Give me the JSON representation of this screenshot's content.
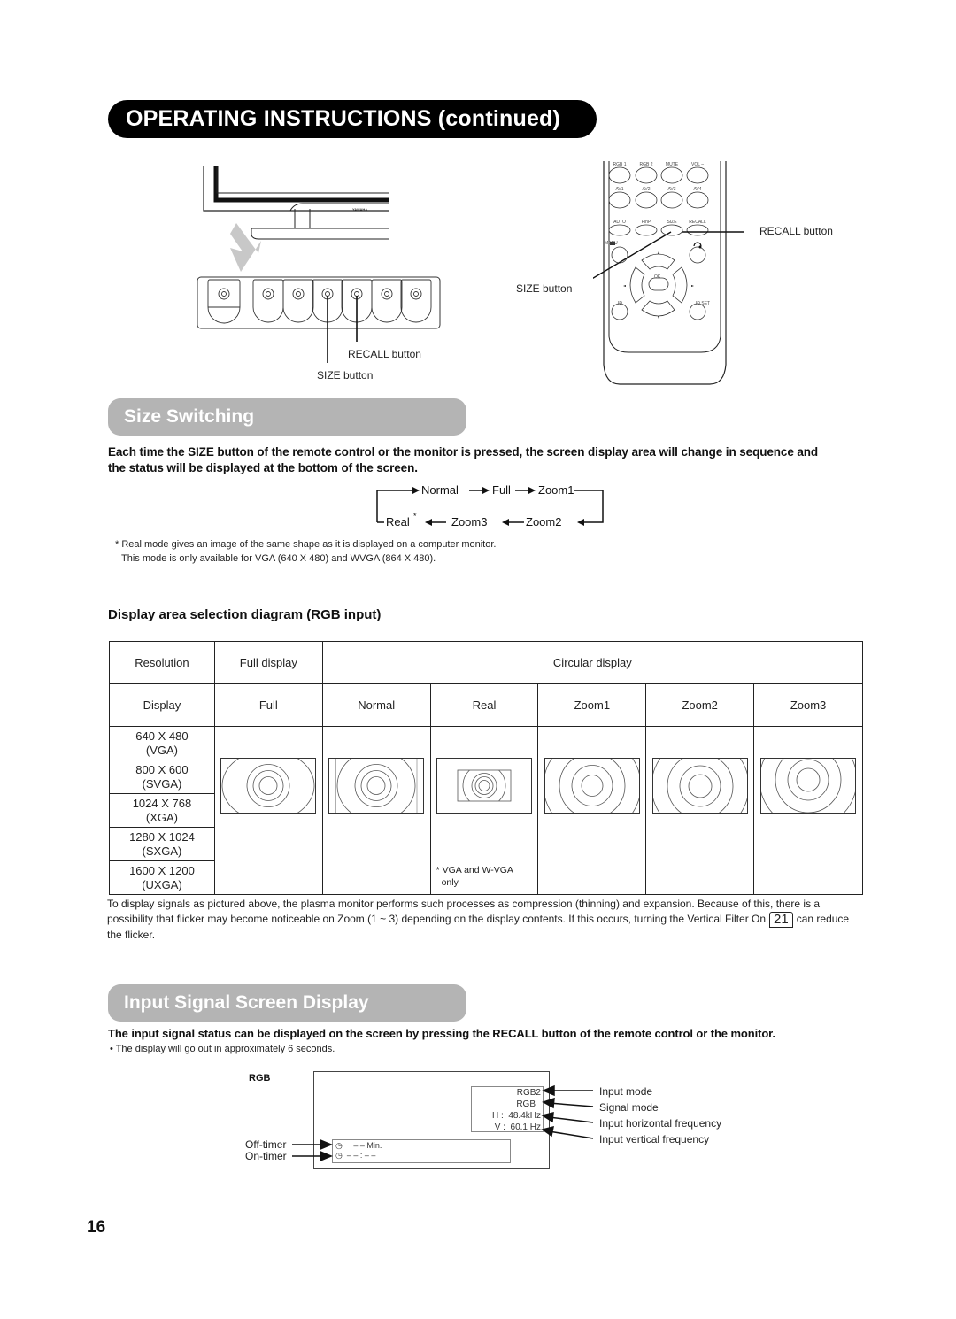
{
  "header": {
    "title": "OPERATING INSTRUCTIONS (continued)"
  },
  "monitor_figure": {
    "brand_mark": "YAMAHA",
    "callouts": {
      "recall": "RECALL button",
      "size": "SIZE button"
    }
  },
  "remote_figure": {
    "button_rows": [
      [
        "RGB 1",
        "RGB 2",
        "MUTE",
        "VOL –"
      ],
      [
        "AV1",
        "AV2",
        "AV3",
        "AV4"
      ],
      [
        "AUTO",
        "PinP",
        "SIZE",
        "RECALL"
      ]
    ],
    "menu_label": "MENU",
    "ok_label": "OK",
    "id_label": "ID",
    "id_set_label": "ID SET",
    "callouts": {
      "recall": "RECALL button",
      "size": "SIZE button"
    }
  },
  "size_switching": {
    "title": "Size Switching",
    "intro": "Each time the SIZE button of the remote control or the monitor is pressed, the screen display area will change in sequence and the status will be displayed at the bottom of the screen.",
    "cycle_top": [
      "Normal",
      "Full",
      "Zoom1"
    ],
    "cycle_bottom": [
      "Real",
      "Zoom3",
      "Zoom2"
    ],
    "real_asterisk": "*",
    "footnote_line1": "* Real mode gives an image of the same shape as it is displayed on a computer monitor.",
    "footnote_line2": "This mode is only available for VGA (640 X 480) and WVGA (864 X 480)."
  },
  "display_area": {
    "heading": "Display area selection diagram (RGB input)",
    "header_row": {
      "resolution": "Resolution",
      "full_display": "Full display",
      "circular_display": "Circular display"
    },
    "display_row": [
      "Display",
      "Full",
      "Normal",
      "Real",
      "Zoom1",
      "Zoom2",
      "Zoom3"
    ],
    "resolutions": [
      {
        "res": "640 X 480",
        "name": "(VGA)"
      },
      {
        "res": "800 X 600",
        "name": "(SVGA)"
      },
      {
        "res": "1024 X 768",
        "name": "(XGA)"
      },
      {
        "res": "1280 X 1024",
        "name": "(SXGA)"
      },
      {
        "res": "1600 X 1200",
        "name": "(UXGA)"
      }
    ],
    "real_note_line1": "* VGA and W-VGA",
    "real_note_line2": "only",
    "note_before": "To display signals as pictured above, the plasma monitor performs such processes as compression (thinning) and expansion. Because of this, there is a possibility that flicker may become noticeable on Zoom (1 ~ 3) depending on the display contents. If this occurs, turning the Vertical Filter On",
    "page_ref": "21",
    "note_after": "can reduce the flicker."
  },
  "input_signal": {
    "title": "Input Signal Screen Display",
    "intro": "The input signal status can be displayed on the screen by pressing the RECALL button of the remote control or the monitor.",
    "bullet": "• The display will go out in approximately 6 seconds.",
    "osd_label": "RGB",
    "osd": {
      "input_mode": "RGB2",
      "signal_mode": "RGB",
      "h_label": "H :",
      "h_value": "48.4kHz",
      "v_label": "V :",
      "v_value": "60.1  Hz",
      "off_timer_value": "– –  Min.",
      "on_timer_value": "– – : – –"
    },
    "callouts_right": [
      "Input mode",
      "Signal mode",
      "Input horizontal frequency",
      "Input vertical frequency"
    ],
    "callouts_left": [
      "Off-timer",
      "On-timer"
    ]
  },
  "page_number": "16"
}
